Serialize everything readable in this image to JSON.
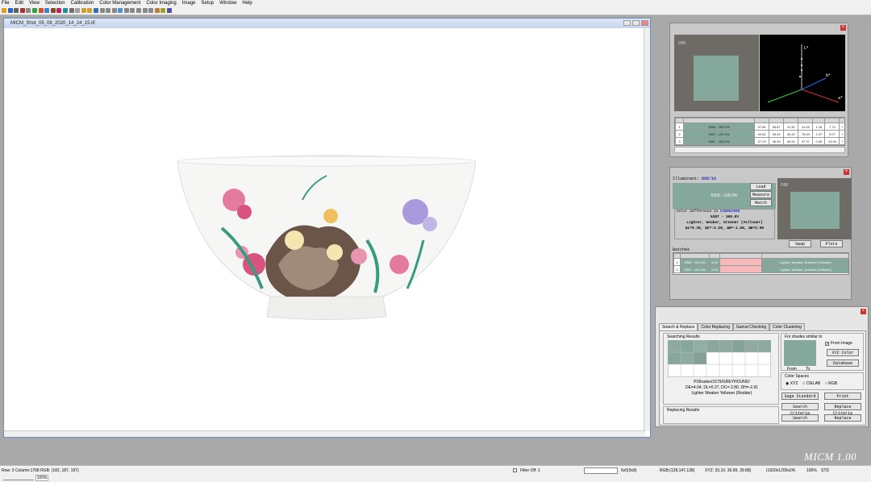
{
  "menu": [
    "File",
    "Edit",
    "View",
    "Selection",
    "Calibration",
    "Color Management",
    "Color Imaging",
    "Image",
    "Setup",
    "Window",
    "Help"
  ],
  "image_window": {
    "title": "MICM_Shot_05_08_2020_14_24_15.tif"
  },
  "top_panel": {
    "swatch_label": "D65",
    "axis_labels": {
      "L": "L*",
      "a": "a*",
      "b": "b*"
    },
    "rows": [
      {
        "idx": "1",
        "name": "5305 - 100.0%",
        "v": [
          "37.66",
          "35.87",
          "41.30",
          "14.93",
          "1.15",
          "7.72",
          "+"
        ]
      },
      {
        "idx": "2",
        "name": "5307 - 100.0%",
        "v": [
          "40.64",
          "35.42",
          "40.42",
          "75.63",
          "1.37",
          "9.07",
          "+"
        ]
      },
      {
        "idx": "3",
        "name": "5467 - 100.0%",
        "v": [
          "37.23",
          "36.39",
          "40.90",
          "97.37",
          "0.26",
          "13.94",
          "+"
        ]
      }
    ]
  },
  "mid_panel": {
    "illuminant_label": "Illuminant:",
    "illuminant_value": "D65/10",
    "swatch_text": "5305 - 100.0%",
    "buttons_right": [
      "Load",
      "Measure",
      "Match"
    ],
    "diff_label": "Color difference in",
    "diff_model": "CIEDE2000",
    "diff_line1": "5307 - 100.0%",
    "diff_line2": "Lighter, Weaker, Greener (Yellower)",
    "diff_line3": "ΔL=0.35, ΔC=-2.26, ΔH=-1.68, ΔE=2.05",
    "swatch2_label": "D65",
    "swap": "Swap",
    "plots": "Plots",
    "batches_label": "Batches",
    "batch_rows": [
      {
        "idx": "1",
        "name": "5305 - 100.0%",
        "v": "0.00",
        "desc": "Lighter, Weaker, Greener (Yellower)"
      },
      {
        "idx": "2",
        "name": "5307 - 100.0%",
        "v": "2.05",
        "desc": "Lighter, Weaker, Greener (Yellower)"
      }
    ]
  },
  "search_panel": {
    "tabs": [
      "Search & Replace",
      "Color Replacing",
      "Gamut Checking",
      "Color Clustering"
    ],
    "searching_results": "Searching Results",
    "result_line1": "P/Shades/1579/GREYHOUND/",
    "result_line2": "DE=4.04, DL=0.27, DC=-2.80, DH=-2.91",
    "result_line3": "Lighter Weaker Yellower (Redder)",
    "replacing_results": "Replacing Results",
    "for_shades": "For shades similar to",
    "from_image": "From Image",
    "from": "From",
    "to": "To",
    "xyz_color": "XYZ Color",
    "database": "Database",
    "color_spaces": "Color Spaces",
    "spaces": [
      "XYZ",
      "CIELAB",
      "RGB"
    ],
    "buttons": [
      "Sage Standard",
      "Print",
      "Search Criteria",
      "Replace Criteria",
      "Search",
      "Replace"
    ]
  },
  "watermark": "MICM 1.00",
  "status": {
    "row_col": "Row:  3 Column:1768  RGB: (182, 187, 197)",
    "zoom_left": "100%",
    "filter": "Filter Off:  1",
    "size": "5x5(9x9)",
    "rgb": "RGB:(128,147,138)",
    "xyz": "XYZ: 33.10, 36.99, 39.88)",
    "dims": "(1920x1200x24)",
    "zoom": "100%",
    "std": "STD"
  },
  "colors": {
    "swatch": "#84a89c",
    "panel": "#c8c8c8",
    "title_bar": "#c5d5ec"
  }
}
